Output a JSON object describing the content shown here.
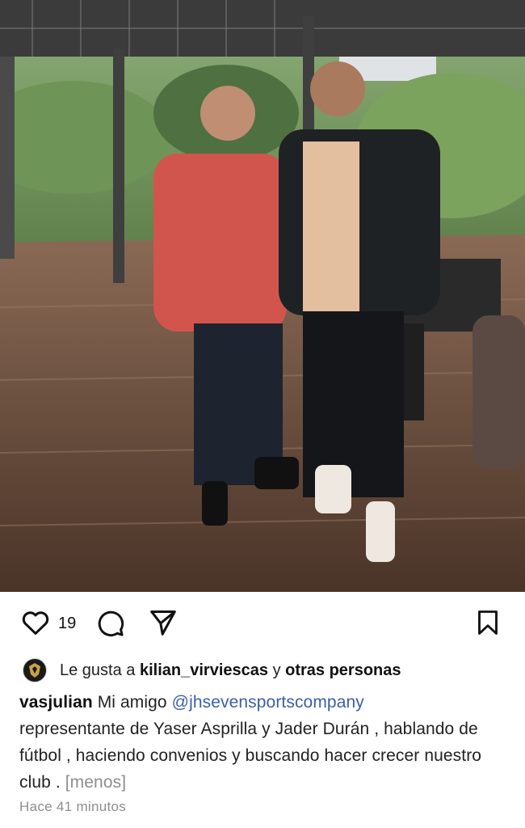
{
  "post": {
    "image_alt": "Two men standing together indoors on a polished wood floor in front of glass windows with garden view",
    "likes_count": "19",
    "liked_by_prefix": "Le gusta a",
    "liked_by_user": "kilian_virviescas",
    "liked_by_connector": "y",
    "liked_by_others": "otras personas",
    "caption_user": "vasjulian",
    "caption_text_1": "Mi amigo",
    "caption_mention": "@jhsevensportscompany",
    "caption_text_2": "representante de Yaser Asprilla y Jader Durán , hablando de fútbol , haciendo convenios y buscando hacer crecer nuestro club .",
    "caption_less": "[menos]",
    "timestamp": "Hace 41 minutos"
  },
  "icons": {
    "like": "heart-icon",
    "comment": "comment-icon",
    "share": "send-icon",
    "save": "bookmark-icon"
  },
  "colors": {
    "mention": "#3a5fa8",
    "secondary_text": "#8e8e8e"
  }
}
